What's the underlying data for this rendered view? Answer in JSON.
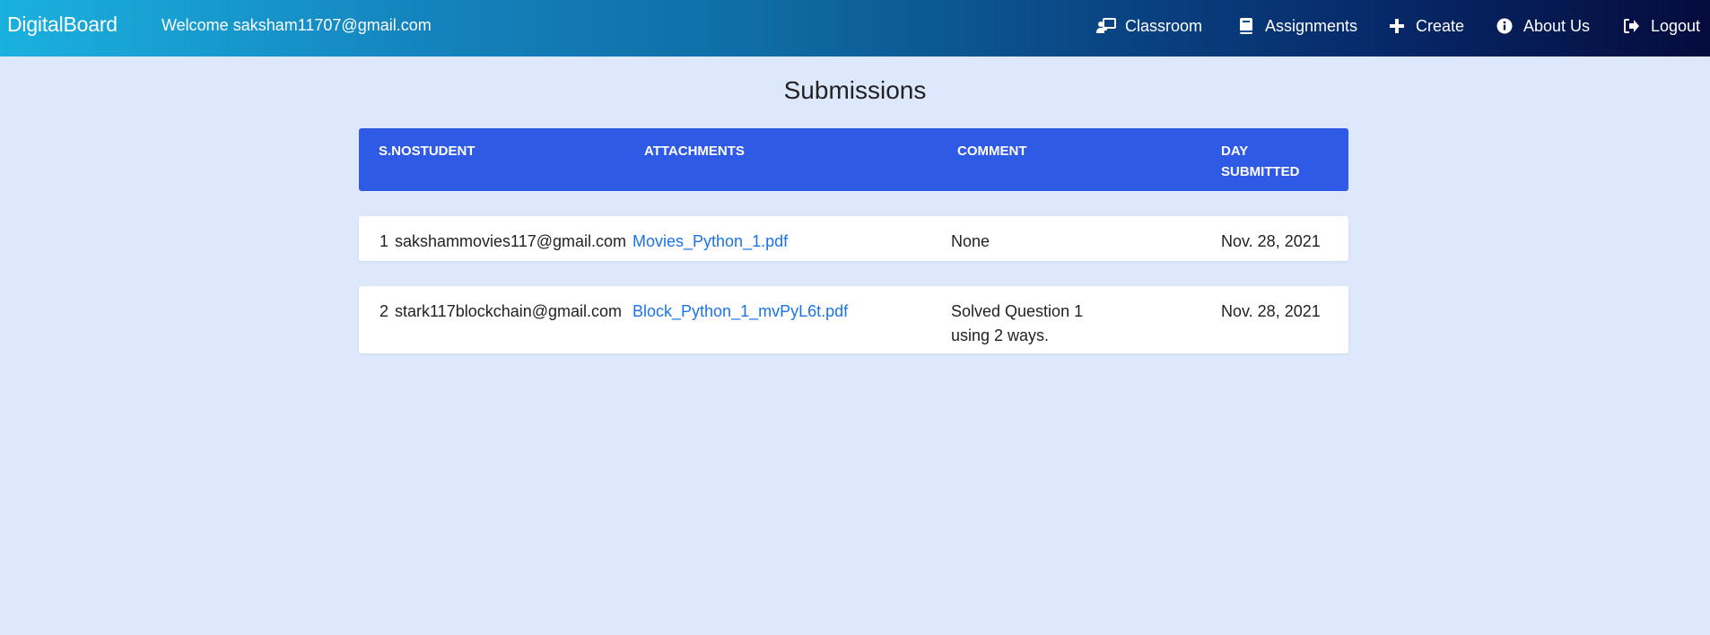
{
  "navbar": {
    "brand": "DigitalBoard",
    "welcome": "Welcome saksham11707@gmail.com",
    "links": [
      {
        "label": "Classroom",
        "icon": "classroom-icon"
      },
      {
        "label": "Assignments",
        "icon": "book-icon"
      },
      {
        "label": "Create",
        "icon": "plus-icon"
      },
      {
        "label": "About Us",
        "icon": "info-icon"
      },
      {
        "label": "Logout",
        "icon": "logout-icon"
      }
    ]
  },
  "page": {
    "title": "Submissions"
  },
  "table": {
    "headers": {
      "sno_student": "S.NOSTUDENT",
      "attachments": "ATTACHMENTS",
      "comment": "COMMENT",
      "day_submitted": "DAY SUBMITTED"
    },
    "rows": [
      {
        "sno": "1",
        "student": "sakshammovies117@gmail.com",
        "attachment": "Movies_Python_1.pdf",
        "comment": "None",
        "date": "Nov. 28, 2021"
      },
      {
        "sno": "2",
        "student": "stark117blockchain@gmail.com",
        "attachment": "Block_Python_1_mvPyL6t.pdf",
        "comment": "Solved Question 1 using 2 ways.",
        "date": "Nov. 28, 2021"
      }
    ]
  },
  "colors": {
    "page_bg": "#dee8fd",
    "table_header_bg": "#2f5ae6",
    "link": "#1a73e8"
  }
}
